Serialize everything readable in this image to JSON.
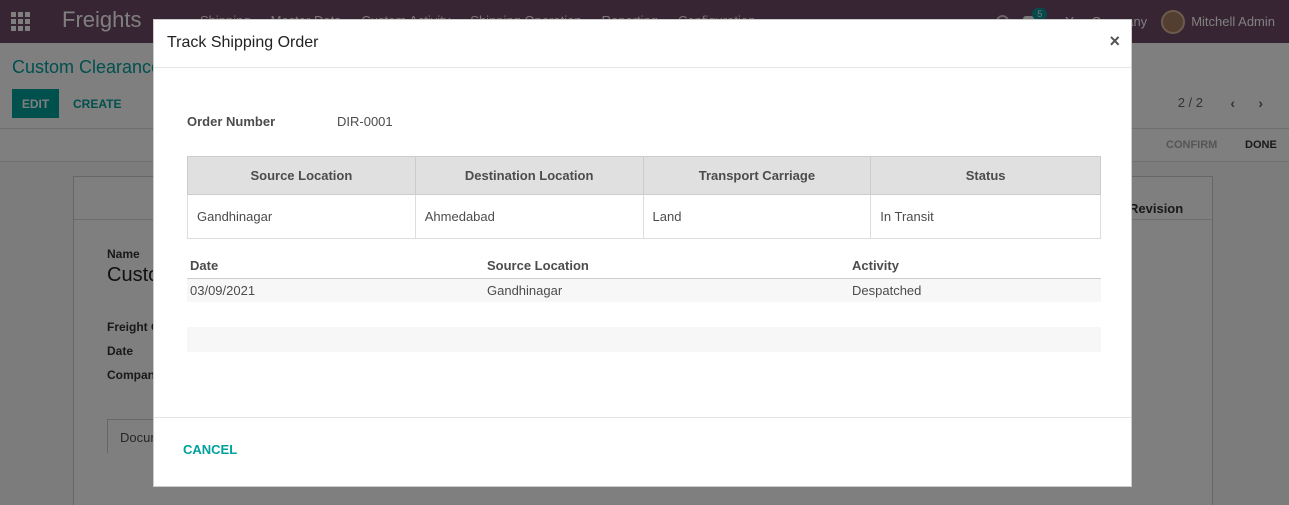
{
  "navbar": {
    "brand": "Freights",
    "menu": [
      "Shipping",
      "Master Data",
      "Custom Activity",
      "Shipping Operation",
      "Reporting",
      "Configuration"
    ],
    "chat_count": "5",
    "company": "YourCompany",
    "user": "Mitchell Admin"
  },
  "control": {
    "title": "Custom Clearance",
    "edit_label": "EDIT",
    "create_label": "CREATE",
    "pager": "2 / 2",
    "prev_icon": "‹",
    "next_icon": "›"
  },
  "statusbar": {
    "confirm": "CONFIRM",
    "done": "DONE"
  },
  "sheet": {
    "revision": "Revision",
    "name_label": "Name",
    "name_value": "Custo",
    "freight_label": "Freight O",
    "date_label": "Date",
    "company_label": "Compan",
    "tab_doc": "Docum"
  },
  "modal": {
    "title": "Track Shipping Order",
    "close_symbol": "×",
    "order_label": "Order Number",
    "order_value": "DIR-0001",
    "route_table": {
      "headers": [
        "Source Location",
        "Destination Location",
        "Transport Carriage",
        "Status"
      ],
      "row": [
        "Gandhinagar",
        "Ahmedabad",
        "Land",
        "In Transit"
      ]
    },
    "activity_table": {
      "headers": [
        "Date",
        "Source Location",
        "Activity"
      ],
      "rows": [
        [
          "03/09/2021",
          "Gandhinagar",
          "Despatched"
        ]
      ]
    },
    "cancel_label": "CANCEL"
  }
}
